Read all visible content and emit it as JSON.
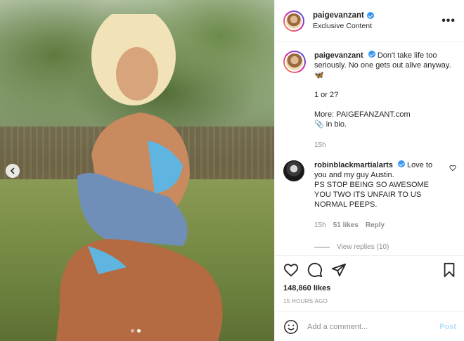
{
  "post": {
    "photo_alt": "",
    "carousel_dots": 2,
    "carousel_active_index": 1
  },
  "header": {
    "username": "paigevanzant",
    "subline": "Exclusive Content",
    "more_label": "•••"
  },
  "caption": {
    "username": "paigevanzant",
    "text": "Don't take life too seriously. No one gets out alive anyway. 🦋",
    "question": "1 or 2?",
    "more_line": "More: PAIGEFANZANT.com",
    "bio_line": "📎 in bio.",
    "time": "15h"
  },
  "comment": {
    "username": "robinblackmartialarts",
    "text": "Love to you and my guy Austin.",
    "text2": "PS STOP BEING SO AWESOME YOU TWO ITS UNFAIR TO US NORMAL PEEPS.",
    "time": "15h",
    "likes": "51 likes",
    "reply_label": "Reply",
    "view_replies": "View replies (10)"
  },
  "actions": {
    "likes": "148,860 likes",
    "timestamp": "15 HOURS AGO"
  },
  "composer": {
    "placeholder": "Add a comment...",
    "post_label": "Post"
  },
  "colors": {
    "verified": "#3897f0",
    "post_disabled": "#b2dffc",
    "muted": "#8e8e8e"
  }
}
